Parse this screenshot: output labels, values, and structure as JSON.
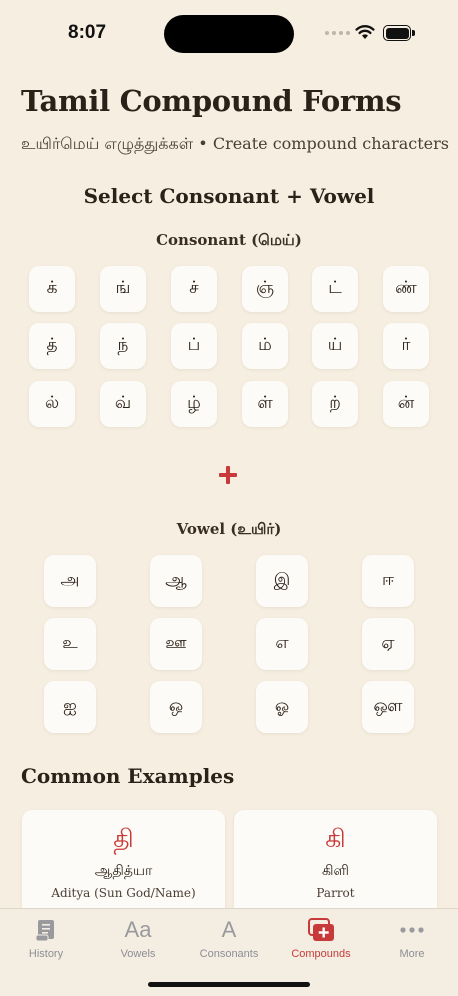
{
  "status_bar": {
    "time": "8:07"
  },
  "header": {
    "title": "Tamil Compound Forms",
    "subtitle": "உயிர்மெய் எழுத்துக்கள் • Create compound characters"
  },
  "selector": {
    "title": "Select Consonant + Vowel",
    "consonant_label": "Consonant (மெய்)",
    "consonants": [
      "க்",
      "ங்",
      "ச்",
      "ஞ்",
      "ட்",
      "ண்",
      "த்",
      "ந்",
      "ப்",
      "ம்",
      "ய்",
      "ர்",
      "ல்",
      "வ்",
      "ழ்",
      "ள்",
      "ற்",
      "ன்"
    ],
    "vowel_label": "Vowel (உயிர்)",
    "vowels": [
      "அ",
      "ஆ",
      "இ",
      "ஈ",
      "உ",
      "ஊ",
      "எ",
      "ஏ",
      "ஐ",
      "ஒ",
      "ஓ",
      "ஔ"
    ]
  },
  "examples": {
    "title": "Common Examples",
    "items": [
      {
        "compound": "தி",
        "word": "ஆதித்யா",
        "meaning": "Aditya (Sun God/Name)"
      },
      {
        "compound": "கி",
        "word": "கிளி",
        "meaning": "Parrot"
      }
    ]
  },
  "tab_bar": {
    "tabs": [
      {
        "label": "History",
        "icon": "scroll-icon"
      },
      {
        "label": "Vowels",
        "icon": "aa-icon"
      },
      {
        "label": "Consonants",
        "icon": "a-icon"
      },
      {
        "label": "Compounds",
        "icon": "stack-plus-icon"
      },
      {
        "label": "More",
        "icon": "ellipsis-icon"
      }
    ],
    "active": "Compounds"
  },
  "colors": {
    "accent": "#c83a3a",
    "background": "#f6efe1",
    "tile": "#fdfbf7",
    "text": "#2b2118"
  }
}
